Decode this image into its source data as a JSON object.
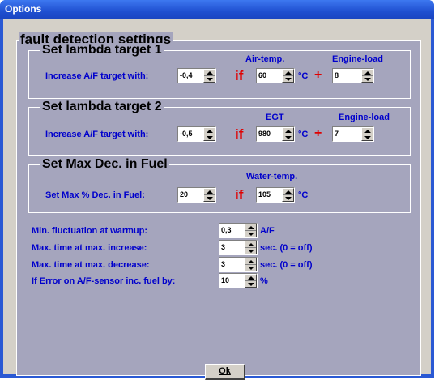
{
  "window": {
    "title": "Options"
  },
  "main_group": {
    "legend": "fault detection settings"
  },
  "target1": {
    "legend": "Set lambda target 1",
    "increase_label": "Increase A/F target with:",
    "increase_value": "-0,4",
    "if_label": "if",
    "airtemp_header": "Air-temp.",
    "airtemp_value": "60",
    "unit_c": "°C",
    "plus": "+",
    "engineload_header": "Engine-load",
    "engineload_value": "8"
  },
  "target2": {
    "legend": "Set lambda target 2",
    "increase_label": "Increase A/F target with:",
    "increase_value": "-0,5",
    "if_label": "if",
    "egt_header": "EGT",
    "egt_value": "980",
    "unit_c": "°C",
    "plus": "+",
    "engineload_header": "Engine-load",
    "engineload_value": "7"
  },
  "maxdec": {
    "legend": "Set Max Dec. in Fuel",
    "label": "Set Max % Dec. in Fuel:",
    "value": "20",
    "if_label": "if",
    "watertemp_header": "Water-temp.",
    "watertemp_value": "105",
    "unit_c": "°C"
  },
  "settings": [
    {
      "label": "Min. fluctuation at warmup:",
      "value": "0,3",
      "unit": "A/F"
    },
    {
      "label": "Max. time at max. increase:",
      "value": "3",
      "unit": "sec. (0 = off)"
    },
    {
      "label": "Max. time at max. decrease:",
      "value": "3",
      "unit": "sec. (0 = off)"
    },
    {
      "label": "If Error on A/F-sensor inc. fuel by:",
      "value": "10",
      "unit": "%"
    }
  ],
  "ok_label": "Ok",
  "colors": {
    "titlebar": "#1f4fd0",
    "panel": "#a5a5bd",
    "label_blue": "#0000cc",
    "accent_red": "#e00000"
  }
}
